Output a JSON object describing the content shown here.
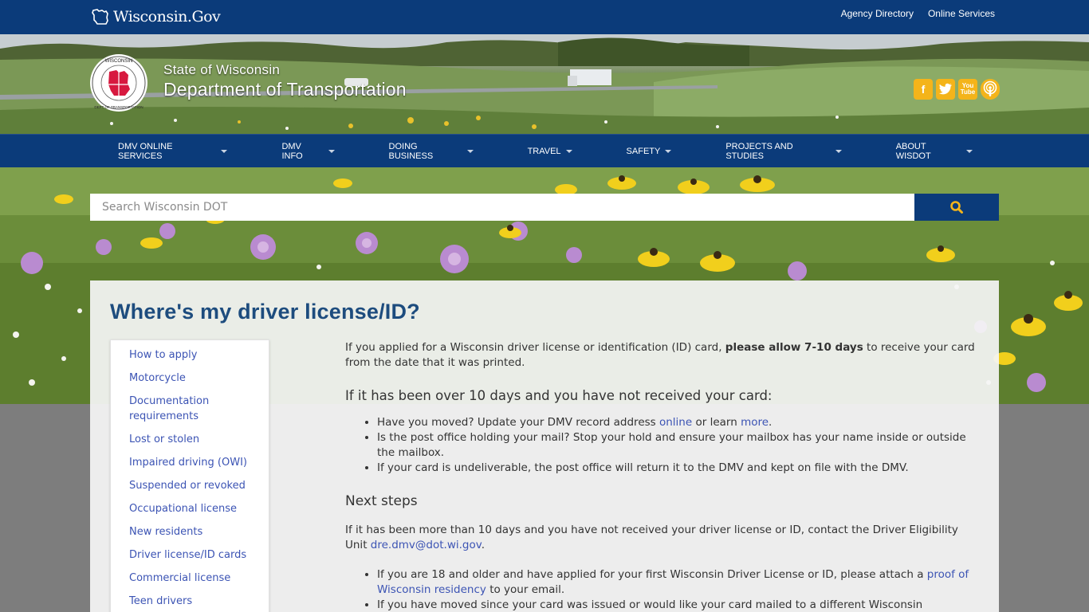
{
  "topbar": {
    "logo_text": "Wisconsin.Gov",
    "links": [
      "Agency Directory",
      "Online Services"
    ]
  },
  "header": {
    "state_name": "State of Wisconsin",
    "department": "Department of Transportation",
    "seal_top": "WISCONSIN",
    "seal_bottom": "DEPARTMENT OF TRANSPORTATION",
    "social": {
      "facebook": "f",
      "twitter": "t",
      "youtube": "You\nTube",
      "podcast": "podcast"
    }
  },
  "nav": {
    "items": [
      "DMV ONLINE SERVICES",
      "DMV INFO",
      "DOING BUSINESS",
      "TRAVEL",
      "SAFETY",
      "PROJECTS AND STUDIES",
      "ABOUT WISDOT"
    ]
  },
  "search": {
    "placeholder": "Search Wisconsin DOT"
  },
  "page": {
    "title": "Where's my driver license/ID?"
  },
  "sidenav": {
    "items": [
      "How to apply",
      "Motorcycle",
      "Documentation requirements",
      "Lost or stolen",
      "Impaired driving (OWI)",
      "Suspended or revoked",
      "Occupational license",
      "New residents",
      "Driver license/ID cards",
      "Commercial license",
      "Teen drivers"
    ]
  },
  "content": {
    "intro_1": "If you applied for a Wisconsin driver license or identification (ID) card, ",
    "intro_bold": "please allow 7-10 days",
    "intro_2": " to receive your card from the date that it was printed.",
    "heading_1": "If it has been over 10 days and you have not received your card:",
    "bullet_1_a": "Have you moved? Update your DMV record address ",
    "bullet_1_link1": "online",
    "bullet_1_b": " or learn ",
    "bullet_1_link2": "more",
    "bullet_1_c": ".",
    "bullet_2": "Is the post office holding your mail? Stop your hold and ensure your mailbox has your name inside or outside the mailbox.",
    "bullet_3": "If your card is undeliverable, the post office will return it to the DMV and kept on file with the DMV.",
    "heading_2": "Next steps",
    "next_1": "If it has been more than 10 days and you have not received your driver license or ID, contact the Driver Eligibility Unit ",
    "next_email": "dre.dmv@dot.wi.gov",
    "next_2": ".",
    "bullet_4_a": "If you are 18 and older and have applied for your first Wisconsin Driver License or ID, please attach a ",
    "bullet_4_link": "proof of Wisconsin residency",
    "bullet_4_b": " to your email.",
    "bullet_5": "If you have moved since your card was issued or would like your card mailed to a different Wisconsin"
  },
  "colors": {
    "brand_blue": "#0b3b7a",
    "link": "#3c54b4",
    "title": "#1d4c7e",
    "social_yellow": "#f4b41a"
  }
}
